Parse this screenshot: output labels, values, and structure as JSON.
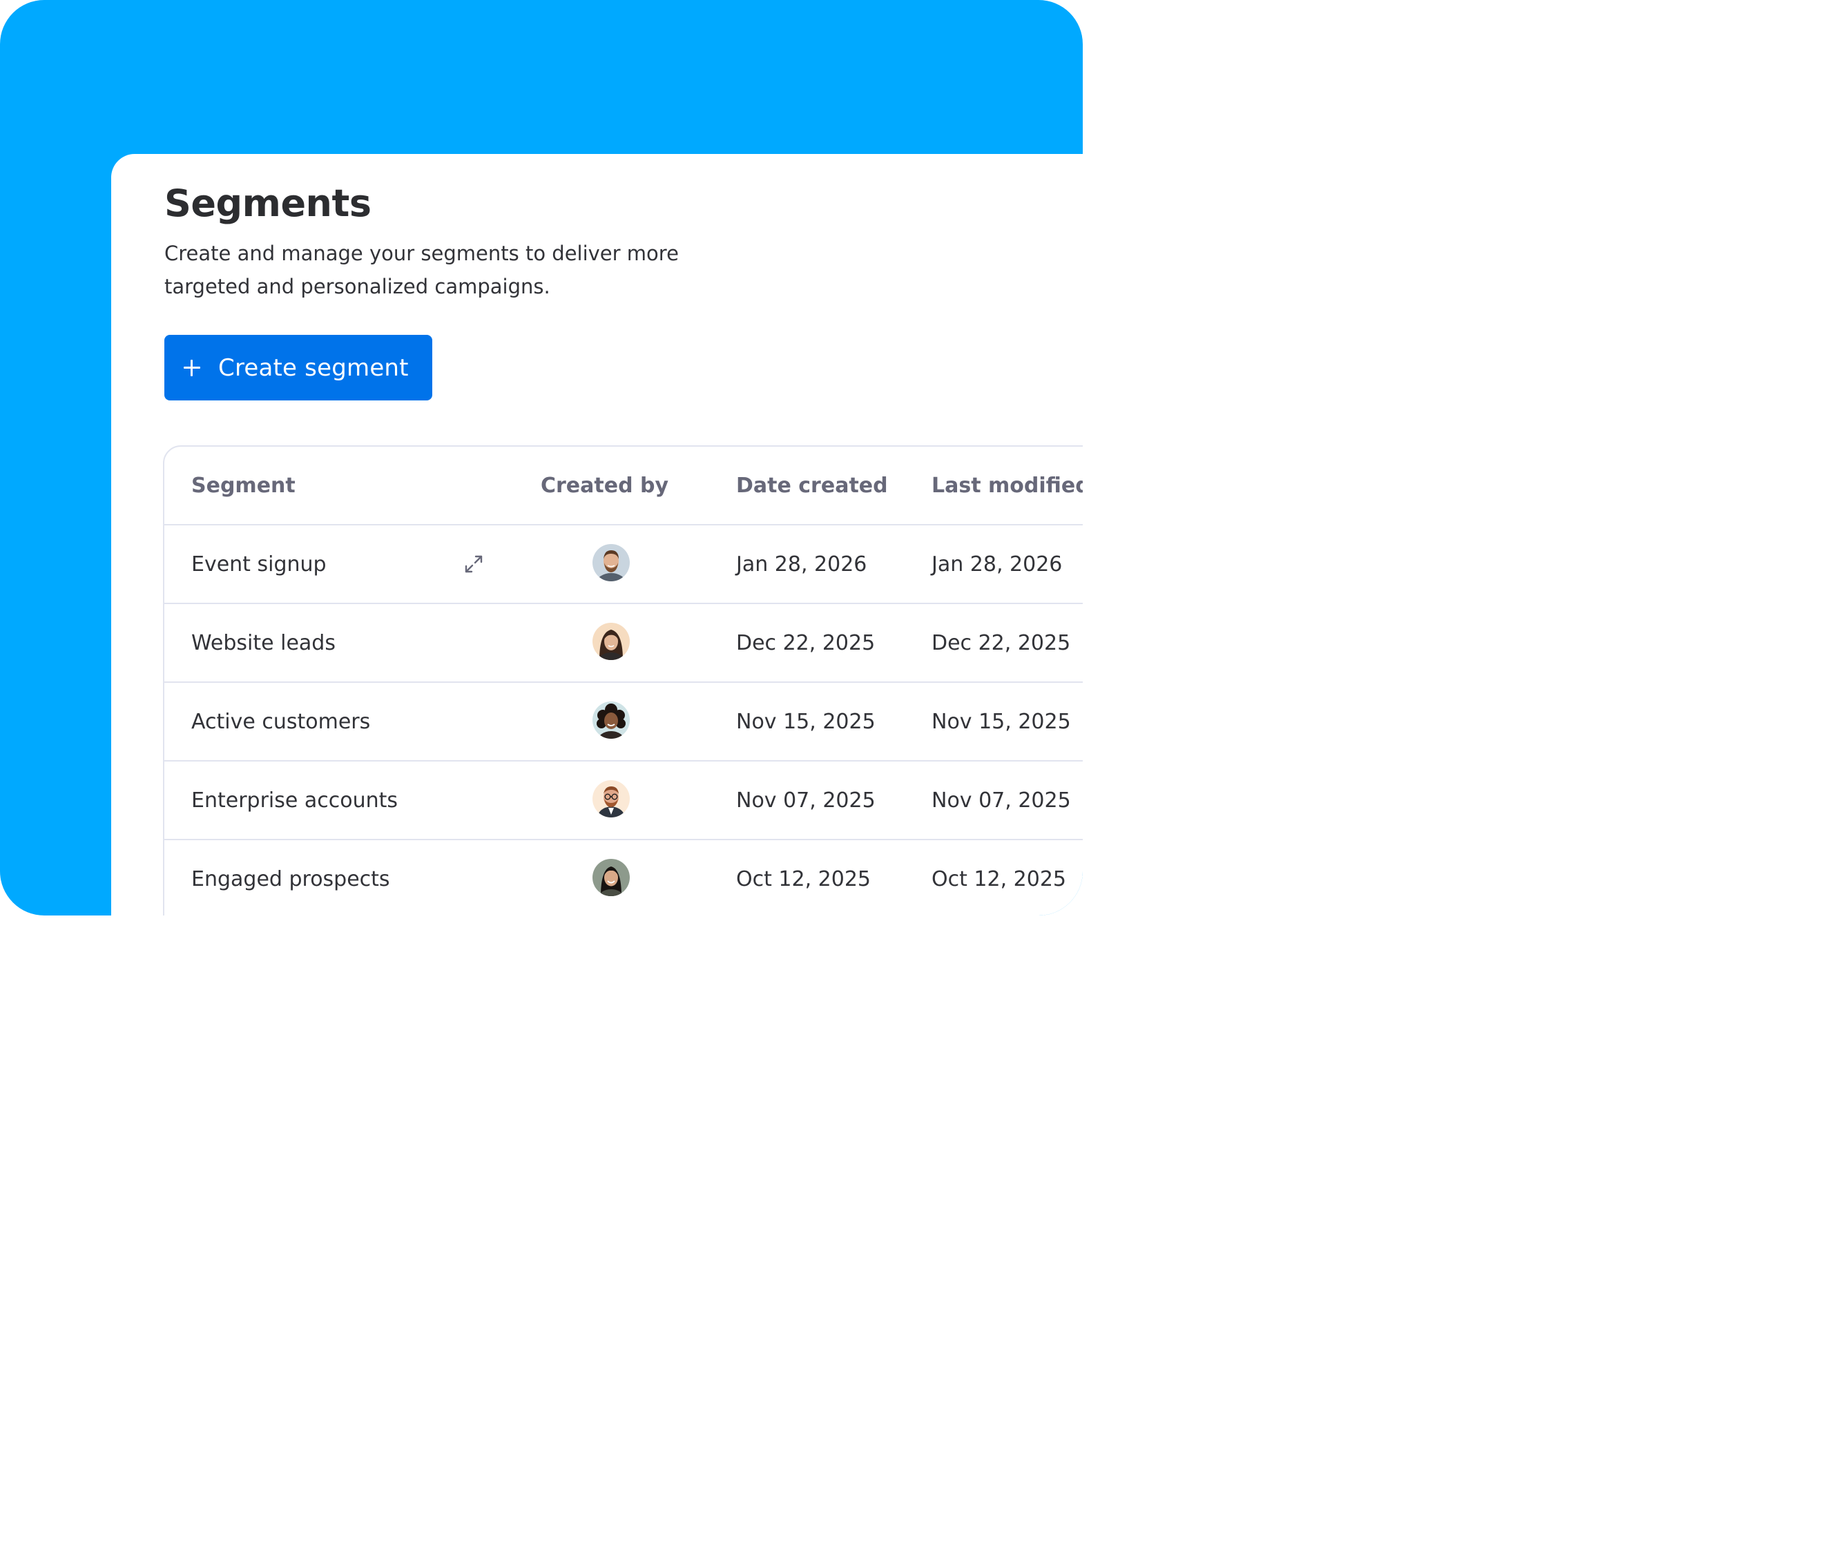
{
  "page": {
    "title": "Segments",
    "description": "Create and manage your segments to deliver more targeted and personalized campaigns."
  },
  "actions": {
    "create_label": "Create segment",
    "create_icon": "plus-icon"
  },
  "colors": {
    "background": "#00a9ff",
    "primary_button": "#0073ea",
    "header_text": "#676879",
    "border": "#e1e4ef"
  },
  "table": {
    "columns": [
      "Segment",
      "Created by",
      "Date created",
      "Last modified"
    ],
    "rows": [
      {
        "segment": "Event signup",
        "created_by": "avatar-man-beard",
        "date_created": "Jan 28, 2026",
        "last_modified": "Jan 28, 2026",
        "hover_icon": "expand-icon"
      },
      {
        "segment": "Website leads",
        "created_by": "avatar-woman-dark-hair",
        "date_created": "Dec 22, 2025",
        "last_modified": "Dec 22, 2025"
      },
      {
        "segment": "Active customers",
        "created_by": "avatar-woman-curly-hair",
        "date_created": "Nov 15, 2025",
        "last_modified": "Nov 15, 2025"
      },
      {
        "segment": "Enterprise accounts",
        "created_by": "avatar-man-glasses",
        "date_created": "Nov 07, 2025",
        "last_modified": "Nov 07, 2025"
      },
      {
        "segment": "Engaged prospects",
        "created_by": "avatar-woman-smiling",
        "date_created": "Oct 12, 2025",
        "last_modified": "Oct 12, 2025"
      }
    ]
  }
}
